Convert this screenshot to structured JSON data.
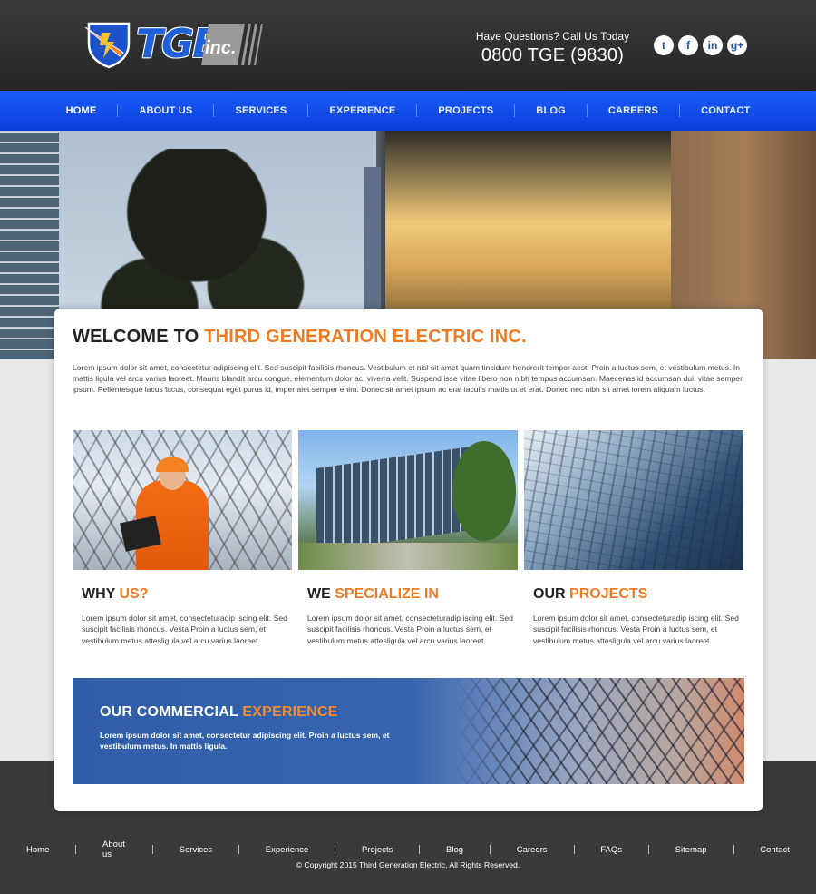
{
  "logo": {
    "text": "TGE",
    "suffix": "inc."
  },
  "contact": {
    "question": "Have Questions? Call Us Today",
    "phone": "0800 TGE (9830)"
  },
  "social": [
    {
      "icon": "twitter-icon",
      "glyph": "t"
    },
    {
      "icon": "facebook-icon",
      "glyph": "f"
    },
    {
      "icon": "linkedin-icon",
      "glyph": "in"
    },
    {
      "icon": "google-plus-icon",
      "glyph": "g+"
    }
  ],
  "nav": [
    "HOME",
    "ABOUT US",
    "SERVICES",
    "EXPERIENCE",
    "PROJECTS",
    "BLOG",
    "CAREERS",
    "CONTACT"
  ],
  "welcome": {
    "prefix": "WELCOME TO",
    "highlight": "THIRD GENERATION ELECTRIC INC.",
    "text": "Lorem ipsum dolor sit amet, consectetur adipiscing elit. Sed suscipit facilisis rhoncus. Vestibulum et nisl sit amet quam tincidunt hendrerit tempor aest. Proin a luctus sem, et vestibulum metus. In mattis ligula vel arcu varius laoreet. Mauris blandit arcu congue, elementum dolor ac, viverra velit. Suspend isse vitae libero non nibh tempus accumsan. Maecenas id accumsan dui, vitae semper ipsum. Pellentesque lacus lacus, consequat eget purus id, imper aiet semper enim. Donec sit amet ipsum ac erat iaculis mattis ut et erat. Donec nec nibh sit amet lorem aliquam luctus."
  },
  "features": [
    {
      "title_a": "WHY",
      "title_b": "US?",
      "text": "Lorem ipsum dolor sit amet, consecteturadip iscing elit. Sed suscipit facilisis rhoncus. Vesta Proin a luctus sem, et vestibulum metus attesligula vel arcu varius laoreet."
    },
    {
      "title_a": "WE",
      "title_b": "SPECIALIZE IN",
      "text": "Lorem ipsum dolor sit amet, consecteturadip iscing elit. Sed suscipit facilisis rhoncus. Vesta Proin a luctus sem, et vestibulum metus attesligula vel arcu varius laoreet."
    },
    {
      "title_a": "OUR",
      "title_b": "PROJECTS",
      "text": "Lorem ipsum dolor sit amet, consecteturadip iscing elit. Sed suscipit facilisis rhoncus. Vesta Proin a luctus sem, et vestibulum metus attesligula vel arcu varius laoreet."
    }
  ],
  "banner": {
    "title_a": "OUR COMMERCIAL",
    "title_b": "EXPERIENCE",
    "text": "Lorem ipsum dolor sit amet, consectetur adipiscing elit. Proin a luctus sem, et vestibulum metus. In mattis ligula."
  },
  "footer": {
    "links": [
      "Home",
      "About us",
      "Services",
      "Experience",
      "Projects",
      "Blog",
      "Careers",
      "FAQs",
      "Sitemap",
      "Contact"
    ],
    "copyright": "© Copyright 2015 Third Generation Electric, All Rights Reserved."
  },
  "colors": {
    "accent": "#f07a22",
    "nav": "#0a3fd6",
    "banner": "#2f5da8",
    "header": "#2e2e2e"
  }
}
